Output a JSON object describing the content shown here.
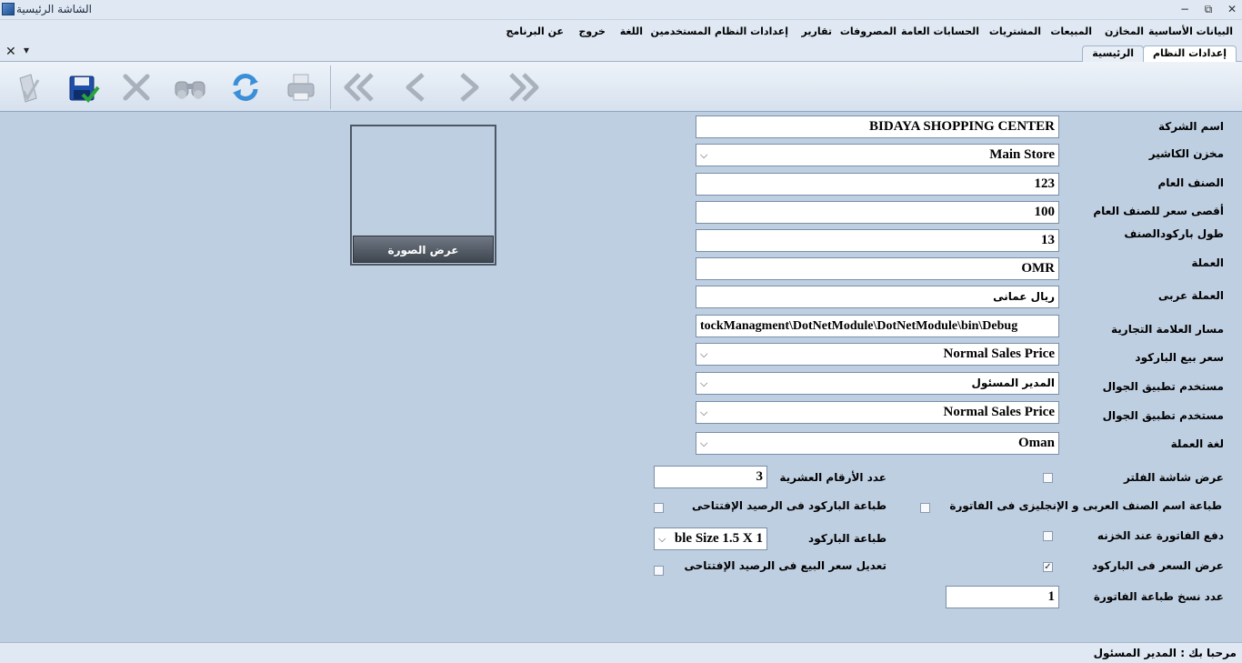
{
  "window": {
    "title": "الشاشة الرئيسية",
    "min": "−",
    "restore": "⧉",
    "close": "✕"
  },
  "menu": [
    {
      "key": "basic",
      "label": "البيانات الأساسية"
    },
    {
      "key": "stores",
      "label": "المخازن"
    },
    {
      "key": "sales",
      "label": "المبيعات"
    },
    {
      "key": "purchases",
      "label": "المشتريات"
    },
    {
      "key": "accounts",
      "label": "الحسابات العامة"
    },
    {
      "key": "expenses",
      "label": "المصروفات"
    },
    {
      "key": "reports",
      "label": "تقارير"
    },
    {
      "key": "settings",
      "label": "إعدادات النظام"
    },
    {
      "key": "users",
      "label": "المستخدمين"
    },
    {
      "key": "language",
      "label": "اللغة"
    },
    {
      "key": "exit",
      "label": "خروج"
    },
    {
      "key": "about",
      "label": "عن البرنامج"
    }
  ],
  "tabs": {
    "settings": "إعدادات النظام",
    "home": "الرئيسية",
    "close": "✕",
    "pin": "▾"
  },
  "toolbar": {
    "icons": [
      "approve-icon",
      "save-icon",
      "delete-icon",
      "search-binoculars-icon",
      "refresh-icon",
      "print-icon",
      "first-record-icon",
      "previous-record-icon",
      "next-record-icon",
      "last-record-icon"
    ]
  },
  "form": {
    "company_name": {
      "label": "اسم الشركة",
      "value": "BIDAYA SHOPPING CENTER"
    },
    "cashier_store": {
      "label": "مخزن الكاشير",
      "value": "Main Store"
    },
    "general_item": {
      "label": "الصنف العام",
      "value": "123"
    },
    "general_item_max_price": {
      "label": "أقصى سعر للصنف العام",
      "value": "100"
    },
    "barcode_length": {
      "label": "طول باركودالصنف",
      "value": "13"
    },
    "currency": {
      "label": "العملة",
      "value": "OMR"
    },
    "currency_ar": {
      "label": "العملة عربى",
      "value": "ريال عمانى"
    },
    "logo_path": {
      "label": "مسار العلامة التجارية",
      "value": "tockManagment\\DotNetModule\\DotNetModule\\bin\\Debug"
    },
    "barcode_sale_price": {
      "label": "سعر بيع الباركود",
      "value": "Normal Sales Price"
    },
    "mobile_user": {
      "label": "مستخدم تطبيق الجوال",
      "value": "المدير المسئول"
    },
    "mobile_user_price": {
      "label": "مستخدم تطبيق الجوال",
      "value": "Normal Sales Price"
    },
    "currency_language": {
      "label": "لغة العملة",
      "value": "Oman"
    },
    "show_filter": {
      "label": "عرض شاشة الفلتر",
      "checked": false
    },
    "decimal_digits": {
      "label": "عدد الأرقام العشرية",
      "value": "3"
    },
    "print_name_bilingual": {
      "label": "طباعة اسم الصنف العربى و الإنجليزى فى الفاتورة",
      "checked": false
    },
    "print_barcode_opening": {
      "label": "طباعة الباركود فى الرصيد الإفتتاحى",
      "checked": false
    },
    "pay_invoice_at_cash": {
      "label": "دفع الفاتورة عند الخزنه",
      "checked": false
    },
    "barcode_print": {
      "label": "طباعة الباركود",
      "value": "ble Size 1.5 X 1"
    },
    "show_price_barcode": {
      "label": "عرض السعر فى الباركود",
      "checked": true
    },
    "edit_sale_price_opening": {
      "label": "تعديل سعر البيع فى الرصيد الإفتتاحى",
      "checked": false
    },
    "invoice_copies": {
      "label": "عدد نسخ طباعة الفاتورة",
      "value": "1"
    }
  },
  "image": {
    "button_label": "عرض الصورة"
  },
  "status": {
    "text": "مرحبا بك :  المدير المسئول"
  },
  "colors": {
    "background": "#bfcfe2",
    "bar": "#dfe8f3",
    "checkmark": "✓"
  }
}
